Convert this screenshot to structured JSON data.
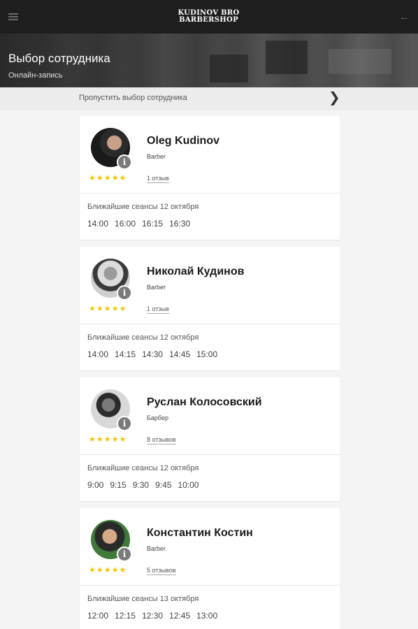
{
  "header": {
    "logo_line1": "KUDINOV BRO",
    "logo_line2": "BARBERSHOP",
    "title": "Выбор сотрудника",
    "subtitle": "Онлайн-запись"
  },
  "skip": {
    "label": "Пропустить выбор сотрудника"
  },
  "icons": {
    "menu": "menu-icon",
    "back": "back-arrow-icon",
    "skip": "chevron-right-icon",
    "info": "info-icon",
    "stars": "star-icon"
  },
  "colors": {
    "topbar": "#1e1e1e",
    "star": "#f5c400",
    "info_badge": "#7a7a7a"
  },
  "staff": [
    {
      "name": "Oleg Kudinov",
      "role": "Barber",
      "rating_stars": 5,
      "stars": "★★★★★",
      "reviews": "1 отзыв",
      "sessions_label": "Ближайшие сеансы 12 октября",
      "slots": [
        "14:00",
        "16:00",
        "16:15",
        "16:30"
      ]
    },
    {
      "name": "Николай Кудинов",
      "role": "Barber",
      "rating_stars": 5,
      "stars": "★★★★★",
      "reviews": "1 отзыв",
      "sessions_label": "Ближайшие сеансы 12 октября",
      "slots": [
        "14:00",
        "14:15",
        "14:30",
        "14:45",
        "15:00"
      ]
    },
    {
      "name": "Руслан Колосовский",
      "role": "Барбер",
      "rating_stars": 5,
      "stars": "★★★★★",
      "reviews": "8 отзывов",
      "sessions_label": "Ближайшие сеансы 12 октября",
      "slots": [
        "9:00",
        "9:15",
        "9:30",
        "9:45",
        "10:00"
      ]
    },
    {
      "name": "Константин Костин",
      "role": "Barber",
      "rating_stars": 5,
      "stars": "★★★★★",
      "reviews": "5 отзывов",
      "sessions_label": "Ближайшие сеансы 13 октября",
      "slots": [
        "12:00",
        "12:15",
        "12:30",
        "12:45",
        "13:00"
      ]
    }
  ]
}
